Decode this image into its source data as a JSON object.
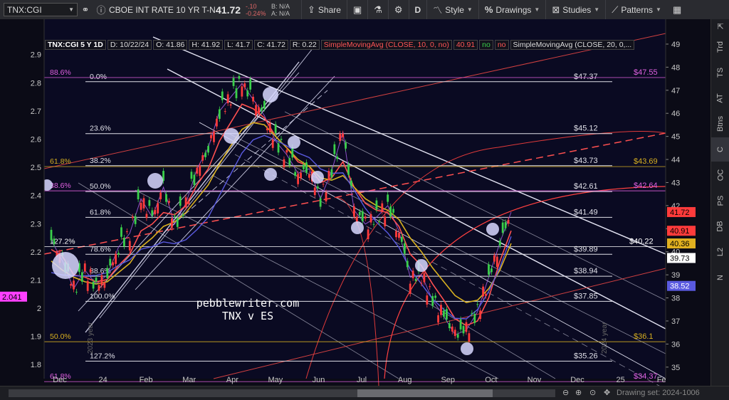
{
  "toolbar": {
    "symbol": "TNX:CGI",
    "description": "CBOE INT RATE 10 YR T-N...",
    "last": "41.72",
    "change": "-.10",
    "change_pct": "-0.24%",
    "bid": "B: N/A",
    "ask": "A: N/A",
    "share": "Share",
    "interval": "D",
    "style": "Style",
    "drawings": "Drawings",
    "studies": "Studies",
    "patterns": "Patterns"
  },
  "header": {
    "symbol": "TNX:CGI 5 Y 1D",
    "date": "D: 10/22/24",
    "open": "O: 41.86",
    "high": "H: 41.92",
    "low": "L: 41.7",
    "close": "C: 41.72",
    "range": "R: 0.22",
    "sma1": "SimpleMovingAvg (CLOSE, 10, 0, no)",
    "sma1_val": "40.91",
    "sma1_flag": "no",
    "sma1_flag2": "no",
    "sma2": "SimpleMovingAvg (CLOSE, 20, 0,..."
  },
  "chart_data": {
    "type": "candlestick",
    "x_ticks": [
      "Dec",
      "24",
      "Feb",
      "Mar",
      "Apr",
      "May",
      "Jun",
      "Jul",
      "Aug",
      "Sep",
      "Oct",
      "Nov",
      "Dec",
      "25",
      "Feb"
    ],
    "left_ticks": [
      "2.9",
      "2.8",
      "2.7",
      "2.6",
      "2.5",
      "2.4",
      "2.3",
      "2.2",
      "2.1",
      "2",
      "1.9",
      "1.8"
    ],
    "right_ticks": [
      "49",
      "48",
      "47",
      "46",
      "45",
      "44",
      "43",
      "42",
      "41",
      "40",
      "39",
      "38",
      "37",
      "36",
      "35"
    ],
    "ylim_right": [
      34.5,
      49.4
    ],
    "ylim_left": [
      1.75,
      2.97
    ],
    "fib_levels": [
      {
        "pct": "0.0%",
        "value": "$47.37",
        "price": 47.37
      },
      {
        "pct": "23.6%",
        "value": "$45.12",
        "price": 45.12
      },
      {
        "pct": "38.2%",
        "value": "$43.73",
        "price": 43.73
      },
      {
        "pct": "50.0%",
        "value": "$42.61",
        "price": 42.61
      },
      {
        "pct": "61.8%",
        "value": "$41.49",
        "price": 41.49
      },
      {
        "pct": "78.6%",
        "value": "$39.89",
        "price": 39.89
      },
      {
        "pct": "88.6%",
        "value": "$38.94",
        "price": 38.94
      },
      {
        "pct": "100.0%",
        "value": "$37.85",
        "price": 37.85
      },
      {
        "pct": "127.2%",
        "value": "$35.26",
        "price": 35.26
      }
    ],
    "outer_fib": [
      {
        "pct": "88.6%",
        "value": "$47.55",
        "price": 47.55,
        "color": "#e060e0"
      },
      {
        "pct": "61.8%",
        "value": "$43.69",
        "price": 43.69,
        "color": "#d8b020"
      },
      {
        "pct": "38.6%",
        "value": "$42.64",
        "price": 42.64,
        "color": "#e060e0"
      },
      {
        "pct": "127.2%",
        "value": "$40.22",
        "price": 40.22,
        "color": "#ffffff"
      },
      {
        "pct": "50.0%",
        "value": "$36.1",
        "price": 36.1,
        "color": "#d8b020"
      },
      {
        "pct": "61.8%",
        "value": "$34.37",
        "price": 34.37,
        "color": "#e060e0"
      }
    ],
    "price_tags": [
      {
        "label": "41.72",
        "price": 41.72,
        "bg": "#ff3b3b",
        "fg": "#000"
      },
      {
        "label": "40.91",
        "price": 40.91,
        "bg": "#ff3b3b",
        "fg": "#000"
      },
      {
        "label": "40.36",
        "price": 40.36,
        "bg": "#e0b020",
        "fg": "#000"
      },
      {
        "label": "39.73",
        "price": 39.73,
        "bg": "#ffffff",
        "fg": "#000"
      },
      {
        "label": "38.52",
        "price": 38.52,
        "bg": "#5a5ae0",
        "fg": "#fff"
      }
    ],
    "left_tag": {
      "label": "2.041",
      "value": 2.041
    },
    "series": [
      {
        "name": "price",
        "values": [
          40.5,
          39.6,
          38.4,
          39.2,
          38.6,
          39.0,
          40.2,
          40.8,
          42.3,
          41.5,
          42.8,
          41.2,
          42.1,
          43.6,
          44.5,
          46.1,
          46.7,
          47.3,
          46.6,
          45.9,
          44.8,
          44.2,
          43.4,
          43.6,
          42.3,
          43.5,
          45.2,
          41.8,
          41.2,
          41.5,
          42.0,
          40.9,
          38.9,
          39.0,
          37.9,
          37.2,
          36.4,
          36.6,
          37.4,
          38.9,
          40.4,
          41.72
        ]
      },
      {
        "name": "SimpleMovingAvg (CLOSE, 10, 0, no)",
        "values": [
          40.1,
          39.8,
          39.0,
          38.9,
          38.7,
          38.8,
          39.4,
          39.9,
          40.9,
          41.2,
          41.7,
          41.6,
          42.0,
          42.9,
          43.6,
          44.8,
          45.6,
          46.4,
          46.2,
          45.8,
          45.0,
          44.5,
          43.9,
          43.7,
          43.0,
          43.2,
          43.9,
          42.8,
          42.1,
          41.8,
          41.7,
          41.1,
          39.9,
          39.4,
          38.6,
          37.9,
          37.1,
          36.8,
          37.0,
          38.0,
          39.6,
          40.91
        ]
      },
      {
        "name": "SimpleMovingAvg (CLOSE, 20, 0,...",
        "values": [
          39.6,
          39.2,
          38.9,
          38.7,
          38.6,
          38.7,
          39.1,
          39.5,
          40.2,
          40.6,
          41.1,
          41.3,
          41.7,
          42.3,
          42.9,
          43.8,
          44.6,
          45.3,
          45.6,
          45.5,
          45.0,
          44.5,
          44.0,
          43.7,
          43.2,
          43.1,
          43.3,
          42.8,
          42.3,
          42.0,
          41.8,
          41.4,
          40.6,
          40.0,
          39.3,
          38.7,
          38.1,
          37.8,
          37.9,
          38.4,
          39.2,
          40.36
        ]
      }
    ],
    "annotation": {
      "line1": "pebblewriter.com",
      "line2": "TNX v ES"
    },
    "watermarks": [
      "2023 year",
      "2024 year"
    ]
  },
  "colors": {
    "sma10": "#ff5050",
    "sma20": "#d8b020",
    "sma50": "#5a5ae0",
    "bull": "#3ad04a",
    "bear": "#ff3b3b",
    "fib": "#c8c8d0"
  },
  "right_tabs": [
    "Trd",
    "TS",
    "AT",
    "Btns",
    "C",
    "OC",
    "PS",
    "DB",
    "L2",
    "N"
  ],
  "footer": {
    "drawing_set": "Drawing set: 2024-1006"
  }
}
